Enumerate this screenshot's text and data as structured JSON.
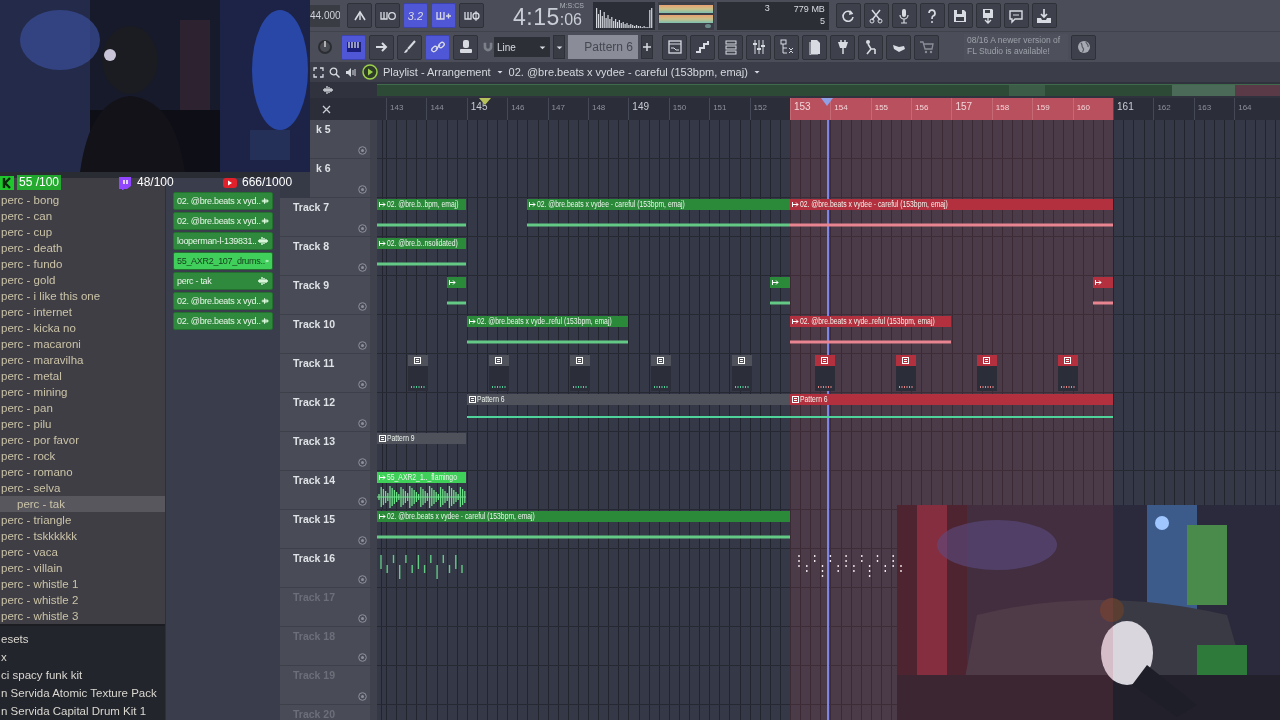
{
  "stream_counters": [
    {
      "color": "#1fc62c",
      "value": "55 /100"
    },
    {
      "color": "#9146ff",
      "value": "48/100"
    },
    {
      "color": "#e0202a",
      "value": "666/1000"
    }
  ],
  "toolbar": {
    "tempo": "44.000",
    "row1_buttons": [
      {
        "selected": false
      },
      {
        "selected": false
      },
      {
        "label": "3.2",
        "selected": true
      },
      {
        "selected": true
      },
      {
        "selected": false
      }
    ],
    "time": "4:15",
    "time_small": ":06",
    "time_unit": "M:S:CS",
    "cpu": {
      "polyphony": "3",
      "memory": "779 MB",
      "value": "5"
    },
    "row2_buttons": [
      {
        "selected": true
      },
      {
        "selected": false
      },
      {
        "selected": false
      },
      {
        "selected": true
      },
      {
        "selected": false
      }
    ],
    "snap": "Line",
    "pattern": "Pattern 6",
    "hint": "08/16  A newer version of FL Studio is available!"
  },
  "browser": {
    "items": [
      {
        "label": "perc - bong",
        "selected": false
      },
      {
        "label": "perc - can",
        "selected": false
      },
      {
        "label": "perc - cup",
        "selected": false
      },
      {
        "label": "perc - death",
        "selected": false
      },
      {
        "label": "perc - fundo",
        "selected": false
      },
      {
        "label": "perc - gold",
        "selected": false
      },
      {
        "label": "perc - i like this one",
        "selected": false
      },
      {
        "label": "perc - internet",
        "selected": false
      },
      {
        "label": "perc - kicka no",
        "selected": false
      },
      {
        "label": "perc - macaroni",
        "selected": false
      },
      {
        "label": "perc - maravilha",
        "selected": false
      },
      {
        "label": "perc - metal",
        "selected": false
      },
      {
        "label": "perc - mining",
        "selected": false
      },
      {
        "label": "perc - pan",
        "selected": false
      },
      {
        "label": "perc - pilu",
        "selected": false
      },
      {
        "label": "perc - por favor",
        "selected": false
      },
      {
        "label": "perc - rock",
        "selected": false
      },
      {
        "label": "perc - romano",
        "selected": false
      },
      {
        "label": "perc - selva",
        "selected": false
      },
      {
        "label": "perc - tak",
        "selected": true
      },
      {
        "label": "perc - triangle",
        "selected": false
      },
      {
        "label": "perc - tskkkkkk",
        "selected": false
      },
      {
        "label": "perc - vaca",
        "selected": false
      },
      {
        "label": "perc - villain",
        "selected": false
      },
      {
        "label": "perc - whistle 1",
        "selected": false
      },
      {
        "label": "perc - whistle 2",
        "selected": false
      },
      {
        "label": "perc - whistle 3",
        "selected": false
      }
    ],
    "packs": [
      "esets",
      "x",
      "ci spacy funk kit",
      "n Servida Atomic Texture Pack",
      "n Servida Capital Drum Kit 1"
    ]
  },
  "picker": [
    {
      "label": "02. @bre.beats x vyd..",
      "selected": false
    },
    {
      "label": "02. @bre.beats x vyd..",
      "selected": false
    },
    {
      "label": "looperman-l-139831..",
      "selected": false
    },
    {
      "label": "55_AXR2_107_drums..",
      "selected": true
    },
    {
      "label": "perc - tak",
      "selected": false
    },
    {
      "label": "02. @bre.beats x vyd..",
      "selected": false
    },
    {
      "label": "02. @bre.beats x vyd..",
      "selected": false
    }
  ],
  "playlist": {
    "title": "Playlist - Arrangement",
    "arrangement": "02. @bre.beats x vydee - careful (153bpm, emaj)",
    "ruler": [
      {
        "label": "143",
        "major": false,
        "selected": false
      },
      {
        "label": "144",
        "major": false,
        "selected": false
      },
      {
        "label": "145",
        "major": true,
        "selected": false
      },
      {
        "label": "146",
        "major": false,
        "selected": false
      },
      {
        "label": "147",
        "major": false,
        "selected": false
      },
      {
        "label": "148",
        "major": false,
        "selected": false
      },
      {
        "label": "149",
        "major": true,
        "selected": false
      },
      {
        "label": "150",
        "major": false,
        "selected": false
      },
      {
        "label": "151",
        "major": false,
        "selected": false
      },
      {
        "label": "152",
        "major": false,
        "selected": false
      },
      {
        "label": "153",
        "major": true,
        "selected": true
      },
      {
        "label": "154",
        "major": false,
        "selected": true
      },
      {
        "label": "155",
        "major": false,
        "selected": true
      },
      {
        "label": "156",
        "major": false,
        "selected": true
      },
      {
        "label": "157",
        "major": true,
        "selected": true
      },
      {
        "label": "158",
        "major": false,
        "selected": true
      },
      {
        "label": "159",
        "major": false,
        "selected": true
      },
      {
        "label": "160",
        "major": false,
        "selected": true
      },
      {
        "label": "161",
        "major": true,
        "selected": false
      },
      {
        "label": "162",
        "major": false,
        "selected": false
      },
      {
        "label": "163",
        "major": false,
        "selected": false
      },
      {
        "label": "164",
        "major": false,
        "selected": false
      }
    ],
    "tracks": [
      {
        "name": "k 5",
        "dimmed": false
      },
      {
        "name": "k 6",
        "dimmed": false
      },
      {
        "name": "Track 7",
        "dimmed": false,
        "clips": [
          {
            "kind": "audio",
            "label": "02. @bre.b..bpm, emaj)",
            "selected": false
          },
          {
            "kind": "audio",
            "label": "02. @bre.beats x vydee - careful (153bpm, emaj)",
            "selected": false
          },
          {
            "kind": "audio",
            "label": "02. @bre.beats x vydee - careful (153bpm, emaj)",
            "selected": true
          }
        ]
      },
      {
        "name": "Track 8",
        "dimmed": false,
        "clips": [
          {
            "kind": "audio",
            "label": "02. @bre.b..nsolidated)",
            "selected": false
          }
        ]
      },
      {
        "name": "Track 9",
        "dimmed": false,
        "clips": [
          {
            "kind": "audio",
            "selected": false
          },
          {
            "kind": "audio",
            "selected": false
          },
          {
            "kind": "audio",
            "selected": true
          }
        ]
      },
      {
        "name": "Track 10",
        "dimmed": false,
        "clips": [
          {
            "kind": "audio",
            "label": "02. @bre.beats x vyde..reful (153bpm, emaj)",
            "selected": false
          },
          {
            "kind": "audio",
            "label": "02. @bre.beats x vyde..reful (153bpm, emaj)",
            "selected": true
          }
        ]
      },
      {
        "name": "Track 11",
        "dimmed": false,
        "clips": [
          {
            "kind": "pattern",
            "selected": false
          },
          {
            "kind": "pattern",
            "selected": false
          },
          {
            "kind": "pattern",
            "selected": false
          },
          {
            "kind": "pattern",
            "selected": false
          },
          {
            "kind": "pattern",
            "selected": false
          },
          {
            "kind": "pattern",
            "selected": true
          },
          {
            "kind": "pattern",
            "selected": true
          },
          {
            "kind": "pattern",
            "selected": true
          },
          {
            "kind": "pattern",
            "selected": true
          }
        ]
      },
      {
        "name": "Track 12",
        "dimmed": false,
        "clips": [
          {
            "kind": "pattern",
            "label": "Pattern 6",
            "selected": false
          },
          {
            "kind": "pattern",
            "label": "Pattern 6",
            "selected": true
          }
        ]
      },
      {
        "name": "Track 13",
        "dimmed": false,
        "clips": [
          {
            "kind": "pattern",
            "label": "Pattern 9",
            "selected": false
          }
        ]
      },
      {
        "name": "Track 14",
        "dimmed": false,
        "clips": [
          {
            "kind": "audio",
            "label": "55_AXR2_1.._flamingo",
            "selected": false
          }
        ]
      },
      {
        "name": "Track 15",
        "dimmed": false,
        "clips": [
          {
            "kind": "audio",
            "label": "02. @bre.beats x vydee - careful (153bpm, emaj)",
            "selected": false
          }
        ]
      },
      {
        "name": "Track 16",
        "dimmed": false,
        "clips": [
          {
            "kind": "hits",
            "selected": false
          },
          {
            "kind": "hits",
            "selected": true
          }
        ]
      },
      {
        "name": "Track 17",
        "dimmed": true
      },
      {
        "name": "Track 18",
        "dimmed": true
      },
      {
        "name": "Track 19",
        "dimmed": true
      },
      {
        "name": "Track 20",
        "dimmed": true
      }
    ]
  }
}
